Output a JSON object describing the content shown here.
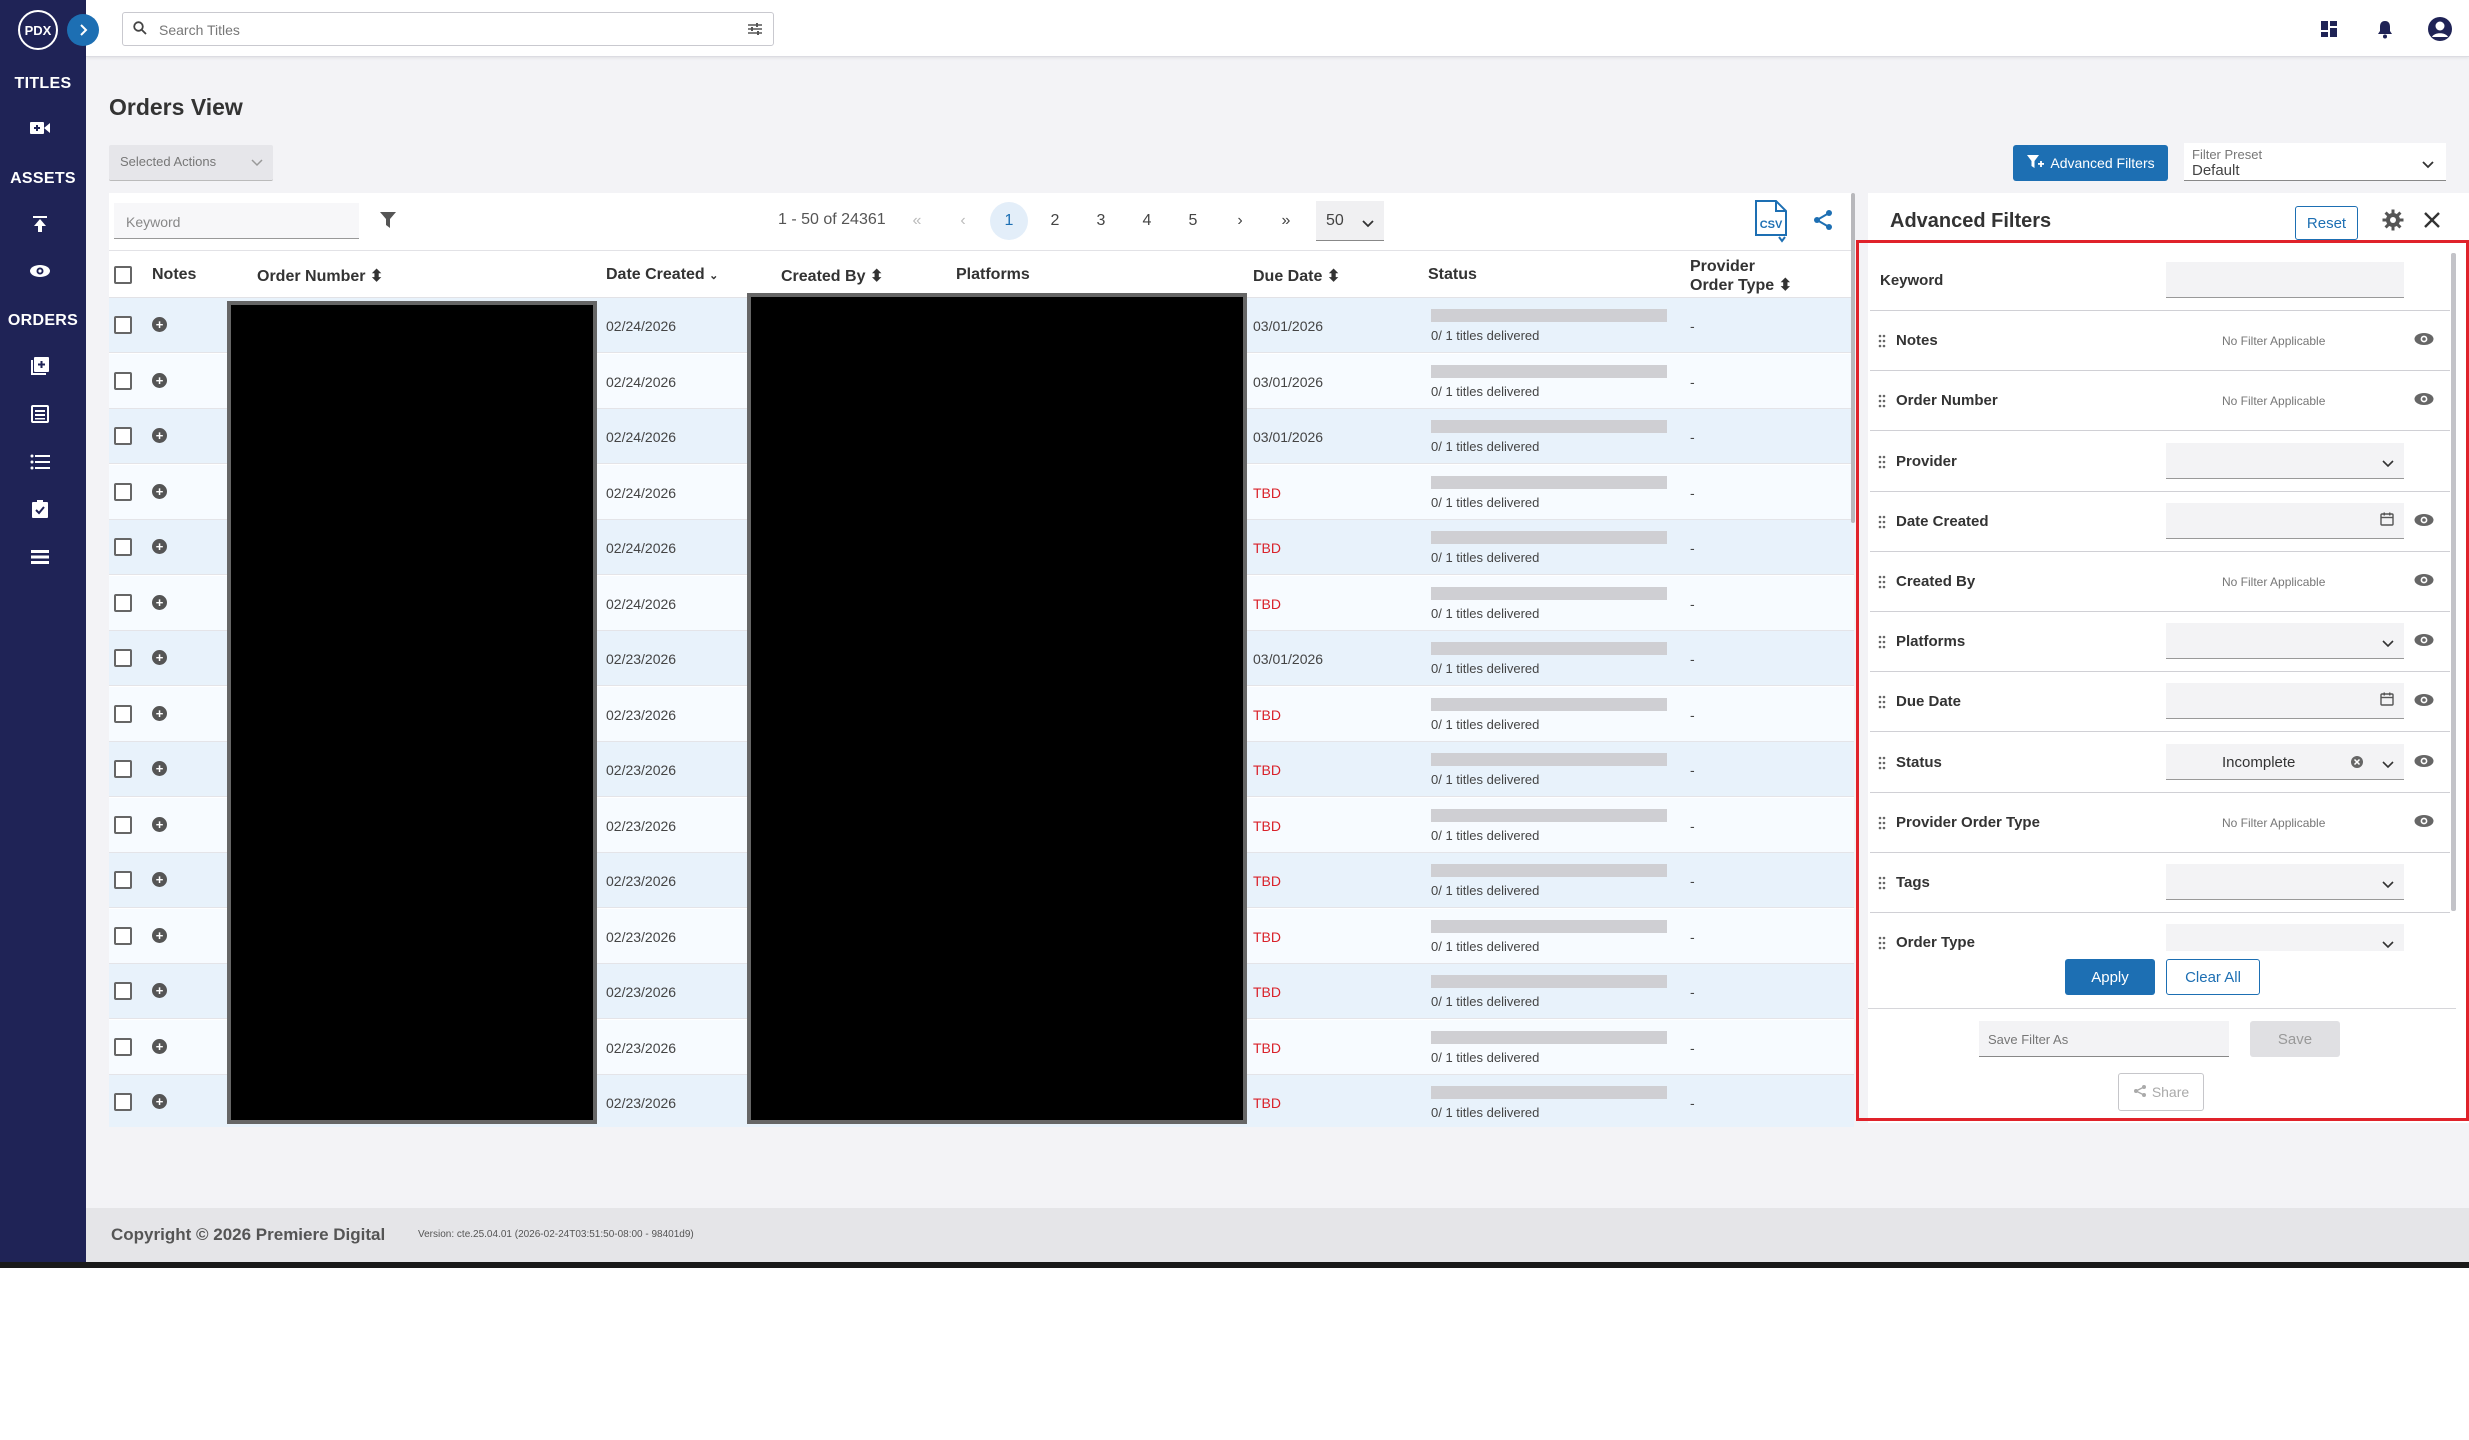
{
  "sidebar": {
    "logo": "PDX",
    "sections": {
      "titles": "TITLES",
      "assets": "ASSETS",
      "orders": "ORDERS"
    },
    "icons": [
      "video-add-icon",
      "upload-icon",
      "eye-icon",
      "add-order-icon",
      "order-list-icon",
      "list-icon",
      "clipboard-check-icon",
      "stack-list-icon"
    ]
  },
  "topbar": {
    "search_placeholder": "Search Titles",
    "icons": [
      "dashboard-icon",
      "bell-icon",
      "account-icon"
    ]
  },
  "page": {
    "title": "Orders View",
    "selected_actions": "Selected Actions",
    "advanced_filters_button": "Advanced Filters",
    "filter_preset_label": "Filter Preset",
    "filter_preset_value": "Default"
  },
  "table": {
    "keyword_placeholder": "Keyword",
    "range": "1 - 50 of 24361",
    "pagination": {
      "first": "«",
      "prev": "‹",
      "pages": [
        "1",
        "2",
        "3",
        "4",
        "5"
      ],
      "active_page": "1",
      "next": "›",
      "last": "»",
      "per_page": "50"
    },
    "csv_label": "CSV",
    "columns": {
      "notes": "Notes",
      "order_number": "Order Number",
      "date_created": "Date Created",
      "created_by": "Created By",
      "platforms": "Platforms",
      "due_date": "Due Date",
      "status": "Status",
      "provider_order_type_line1": "Provider",
      "provider_order_type_line2": "Order Type"
    },
    "rows": [
      {
        "date_created": "02/24/2026",
        "due_date": "03/01/2026",
        "status": "0/ 1 titles delivered",
        "provider_order_type": "-"
      },
      {
        "date_created": "02/24/2026",
        "due_date": "03/01/2026",
        "status": "0/ 1 titles delivered",
        "provider_order_type": "-"
      },
      {
        "date_created": "02/24/2026",
        "due_date": "03/01/2026",
        "status": "0/ 1 titles delivered",
        "provider_order_type": "-"
      },
      {
        "date_created": "02/24/2026",
        "due_date": "TBD",
        "status": "0/ 1 titles delivered",
        "provider_order_type": "-"
      },
      {
        "date_created": "02/24/2026",
        "due_date": "TBD",
        "status": "0/ 1 titles delivered",
        "provider_order_type": "-"
      },
      {
        "date_created": "02/24/2026",
        "due_date": "TBD",
        "status": "0/ 1 titles delivered",
        "provider_order_type": "-"
      },
      {
        "date_created": "02/23/2026",
        "due_date": "03/01/2026",
        "status": "0/ 1 titles delivered",
        "provider_order_type": "-"
      },
      {
        "date_created": "02/23/2026",
        "due_date": "TBD",
        "status": "0/ 1 titles delivered",
        "provider_order_type": "-"
      },
      {
        "date_created": "02/23/2026",
        "due_date": "TBD",
        "status": "0/ 1 titles delivered",
        "provider_order_type": "-"
      },
      {
        "date_created": "02/23/2026",
        "due_date": "TBD",
        "status": "0/ 1 titles delivered",
        "provider_order_type": "-"
      },
      {
        "date_created": "02/23/2026",
        "due_date": "TBD",
        "status": "0/ 1 titles delivered",
        "provider_order_type": "-"
      },
      {
        "date_created": "02/23/2026",
        "due_date": "TBD",
        "status": "0/ 1 titles delivered",
        "provider_order_type": "-"
      },
      {
        "date_created": "02/23/2026",
        "due_date": "TBD",
        "status": "0/ 1 titles delivered",
        "provider_order_type": "-"
      },
      {
        "date_created": "02/23/2026",
        "due_date": "TBD",
        "status": "0/ 1 titles delivered",
        "provider_order_type": "-"
      },
      {
        "date_created": "02/23/2026",
        "due_date": "TBD",
        "status": "0/ 1 titles delivered",
        "provider_order_type": "-"
      }
    ]
  },
  "advanced_filters": {
    "title": "Advanced Filters",
    "reset": "Reset",
    "no_filter_text": "No Filter Applicable",
    "filters": [
      {
        "label": "Keyword",
        "kind": "text"
      },
      {
        "label": "Notes",
        "kind": "none"
      },
      {
        "label": "Order Number",
        "kind": "none"
      },
      {
        "label": "Provider",
        "kind": "select"
      },
      {
        "label": "Date Created",
        "kind": "date"
      },
      {
        "label": "Created By",
        "kind": "none"
      },
      {
        "label": "Platforms",
        "kind": "select"
      },
      {
        "label": "Due Date",
        "kind": "date"
      },
      {
        "label": "Status",
        "kind": "select",
        "value": "Incomplete"
      },
      {
        "label": "Provider Order Type",
        "kind": "none"
      },
      {
        "label": "Tags",
        "kind": "select"
      },
      {
        "label": "Order Type",
        "kind": "select"
      }
    ],
    "apply": "Apply",
    "clear_all": "Clear All",
    "save_filter_placeholder": "Save Filter As",
    "save": "Save",
    "share": "Share"
  },
  "footer": {
    "copyright": "Copyright © 2026 Premiere Digital",
    "version": "Version: cte.25.04.01 (2026-02-24T03:51:50-08:00 - 98401d9)"
  },
  "colors": {
    "sidebar": "#1f2356",
    "accent": "#1d6fb3",
    "tbd": "#d9222a",
    "highlight_border": "#e0222a"
  }
}
